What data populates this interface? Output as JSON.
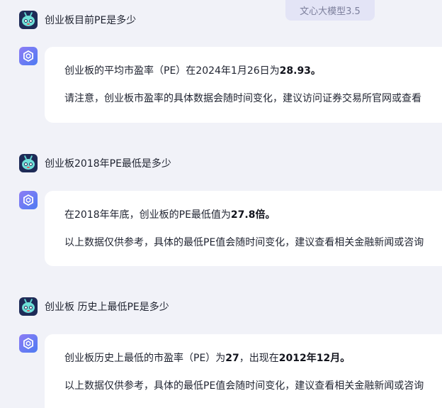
{
  "model_badge": "文心大模型3.5",
  "conversation": [
    {
      "question": "创业板目前PE是多少",
      "answer": {
        "p1_prefix": "创业板的平均市盈率（PE）在2024年1月26日为",
        "p1_bold": "28.93。",
        "p2": "请注意，创业板市盈率的具体数据会随时间变化，建议访问证券交易所官网或查看"
      }
    },
    {
      "question": "创业板2018年PE最低是多少",
      "answer": {
        "p1_prefix": "在2018年年底，创业板的PE最低值为",
        "p1_bold": "27.8倍。",
        "p2": "以上数据仅供参考，具体的最低PE值会随时间变化，建议查看相关金融新闻或咨询"
      }
    },
    {
      "question": "创业板 历史上最低PE是多少",
      "answer": {
        "p1_prefix": "创业板历史上最低的市盈率（PE）为",
        "p1_bold": "27",
        "p1_mid": "，出现在",
        "p1_bold2": "2012年12月。",
        "p2": "以上数据仅供参考，具体的最低PE值会随时间变化，建议查看相关金融新闻或咨询"
      }
    }
  ]
}
